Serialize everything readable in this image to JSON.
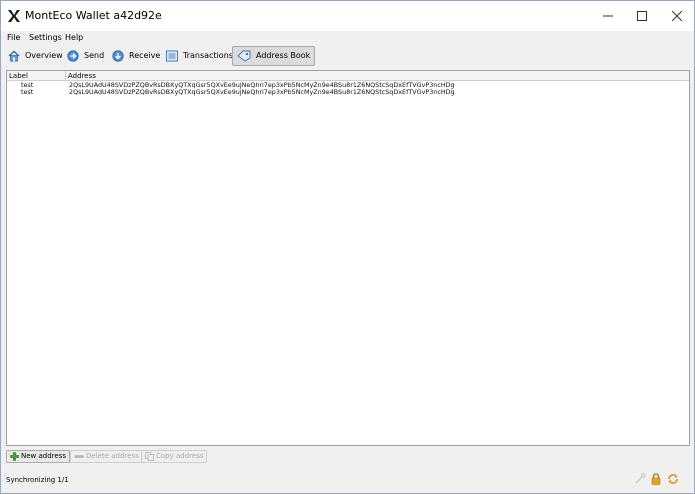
{
  "window": {
    "title": "MontEco Wallet a42d92e"
  },
  "menubar": {
    "items": [
      "File",
      "Settings",
      "Help"
    ]
  },
  "toolbar": {
    "buttons": [
      {
        "label": "Overview",
        "icon": "home-icon"
      },
      {
        "label": "Send",
        "icon": "send-arrow-icon"
      },
      {
        "label": "Receive",
        "icon": "receive-arrow-icon"
      },
      {
        "label": "Transactions",
        "icon": "transactions-list-icon"
      },
      {
        "label": "Address Book",
        "icon": "address-book-icon",
        "active": true
      }
    ]
  },
  "address_table": {
    "columns": [
      "Label",
      "Address"
    ],
    "rows": [
      {
        "label": "test",
        "address": "2QsL9UAdU48SVDzPZQBvRsDBXyQTXqGsr5QXvEe9ujNeQhri7ep3xPb5NcMyZn9e4BSu8r1Z6NQStcSqDxEfTVGvP3ncHDg"
      },
      {
        "label": "test",
        "address": "2QsL9UAdU48SVDzPZQBvRsDBXyQTXqGsr5QXvEe9ujNeQhri7ep3xPb5NcMyZn9e4BSu8r1Z6NQStcSqDxEfTVGvP3ncHDg"
      }
    ]
  },
  "actions": {
    "new_address": "New address",
    "delete_address": "Delete address",
    "copy_address": "Copy address"
  },
  "status": {
    "text": "Synchronizing 1/1",
    "icons": [
      "connection-icon",
      "lock-icon",
      "sync-icon"
    ]
  },
  "colors": {
    "toolbar_active_bg": "#dcdcdc",
    "window_bg": "#f0f0f0",
    "lock_icon": "#e8a21a"
  }
}
